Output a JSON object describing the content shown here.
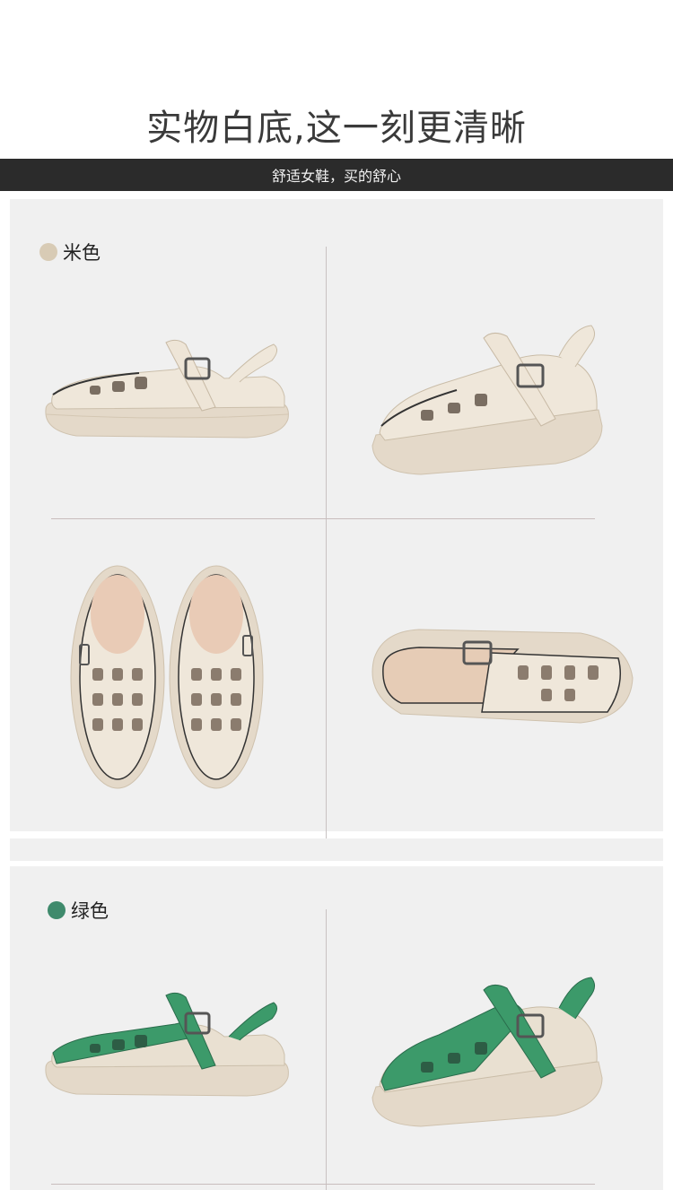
{
  "header": {
    "title": "实物白底,这一刻更清晰",
    "banner_text": "舒适女鞋，买的舒心"
  },
  "colors": {
    "beige_swatch": "#d8cbb5",
    "green_swatch": "#3f8a6c",
    "upper_beige": "#ece4d6",
    "sole": "#e3d9cb",
    "upper_green": "#3c9a6a",
    "banner_bg": "#2b2b2b",
    "panel_bg": "#f0f0f0"
  },
  "sections": [
    {
      "label": "米色"
    },
    {
      "label": "绿色"
    }
  ]
}
